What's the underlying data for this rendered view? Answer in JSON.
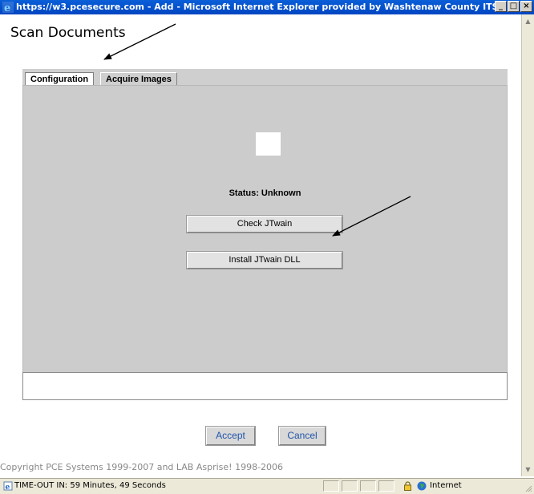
{
  "window": {
    "title": "https://w3.pcesecure.com - Add - Microsoft Internet Explorer provided by Washtenaw County ITS",
    "minimize": "_",
    "maximize": "□",
    "close": "×"
  },
  "page": {
    "title": "Scan Documents",
    "copyright": "Copyright PCE Systems 1999-2007 and LAB Asprise! 1998-2006"
  },
  "tabs": [
    {
      "label": "Configuration",
      "active": true
    },
    {
      "label": "Acquire Images",
      "active": false
    }
  ],
  "panel": {
    "status": "Status: Unknown",
    "check_button": "Check JTwain",
    "install_button": "Install JTwain DLL"
  },
  "dialog": {
    "accept": "Accept",
    "cancel": "Cancel"
  },
  "statusbar": {
    "timeout": "TIME-OUT IN: 59 Minutes, 49 Seconds",
    "zone": "Internet"
  },
  "icons": {
    "browser": "ie-icon",
    "lock": "lock-icon",
    "zone": "globe-icon"
  },
  "colors": {
    "titlebar": "#0a5fd8",
    "panel": "#cccccc",
    "button_text": "#2255aa"
  }
}
